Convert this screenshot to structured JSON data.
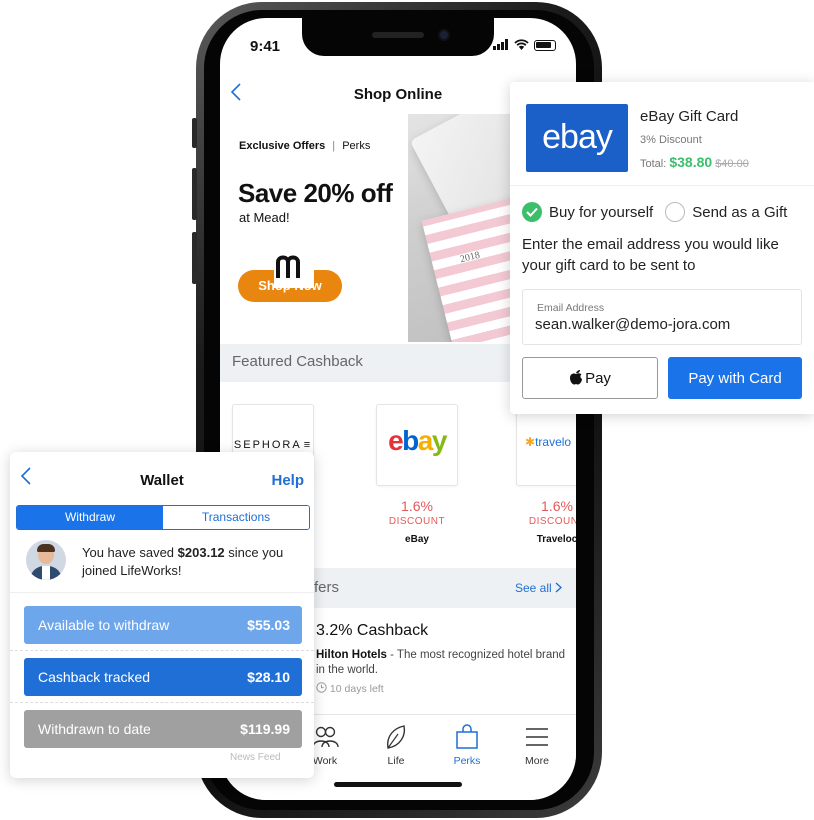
{
  "status_bar": {
    "time": "9:41"
  },
  "shop": {
    "title": "Shop Online",
    "hero": {
      "tag_bold": "Exclusive Offers",
      "tag_sep": "|",
      "tag_rest": "Perks",
      "headline": "Save 20% off",
      "sub": "at Mead!",
      "button": "Shop Now",
      "photo_year": "2018"
    },
    "featured_title": "Featured Cashback",
    "featured": [
      {
        "logo": "SEPHORA",
        "rate": "",
        "discount": "",
        "name": ""
      },
      {
        "logo": "ebay",
        "rate": "1.6%",
        "discount": "DISCOUNT",
        "name": "eBay"
      },
      {
        "logo": "travelo",
        "rate": "1.6%",
        "discount": "DISCOUNT",
        "name": "Traveloc"
      }
    ],
    "offers_title": "fers",
    "see_all": "See all",
    "offer": {
      "title": "3.2% Cashback",
      "brand": "Hilton Hotels",
      "desc": " - The most recognized hotel brand in the world.",
      "time_left": "10 days left"
    },
    "tabs": [
      {
        "label": "Work",
        "icon": "people-icon",
        "active": false
      },
      {
        "label": "Life",
        "icon": "leaf-icon",
        "active": false
      },
      {
        "label": "Perks",
        "icon": "shopping-bag-icon",
        "active": true
      },
      {
        "label": "More",
        "icon": "menu-icon",
        "active": false
      }
    ]
  },
  "wallet": {
    "title": "Wallet",
    "help": "Help",
    "tabs": [
      "Withdraw",
      "Transactions"
    ],
    "saved_prefix": "You have saved ",
    "saved_amount": "$203.12",
    "saved_suffix": " since you joined LifeWorks!",
    "rows": [
      {
        "label": "Available to withdraw",
        "value": "$55.03",
        "color": "#6ea6ec"
      },
      {
        "label": "Cashback tracked",
        "value": "$28.10",
        "color": "#1f6fd6"
      },
      {
        "label": "Withdrawn to date",
        "value": "$119.99",
        "color": "#a0a0a0"
      }
    ],
    "footer_ghost": "News Feed"
  },
  "gift": {
    "logo": "ebay",
    "name": "eBay Gift Card",
    "discount": "3% Discount",
    "total_label": "Total: ",
    "total_price": "$38.80",
    "original_price": "$40.00",
    "option_self": "Buy for yourself",
    "option_gift": "Send as a Gift",
    "prompt": "Enter the email address you would like your gift card to be sent to",
    "email_label": "Email Address",
    "email_value": "sean.walker@demo-jora.com",
    "apple_pay": "Pay",
    "pay_card": "Pay with Card"
  },
  "colors": {
    "accent": "#1a73e8",
    "success": "#3bbf6b",
    "cta": "#e8860f",
    "discount": "#e45a5a"
  }
}
